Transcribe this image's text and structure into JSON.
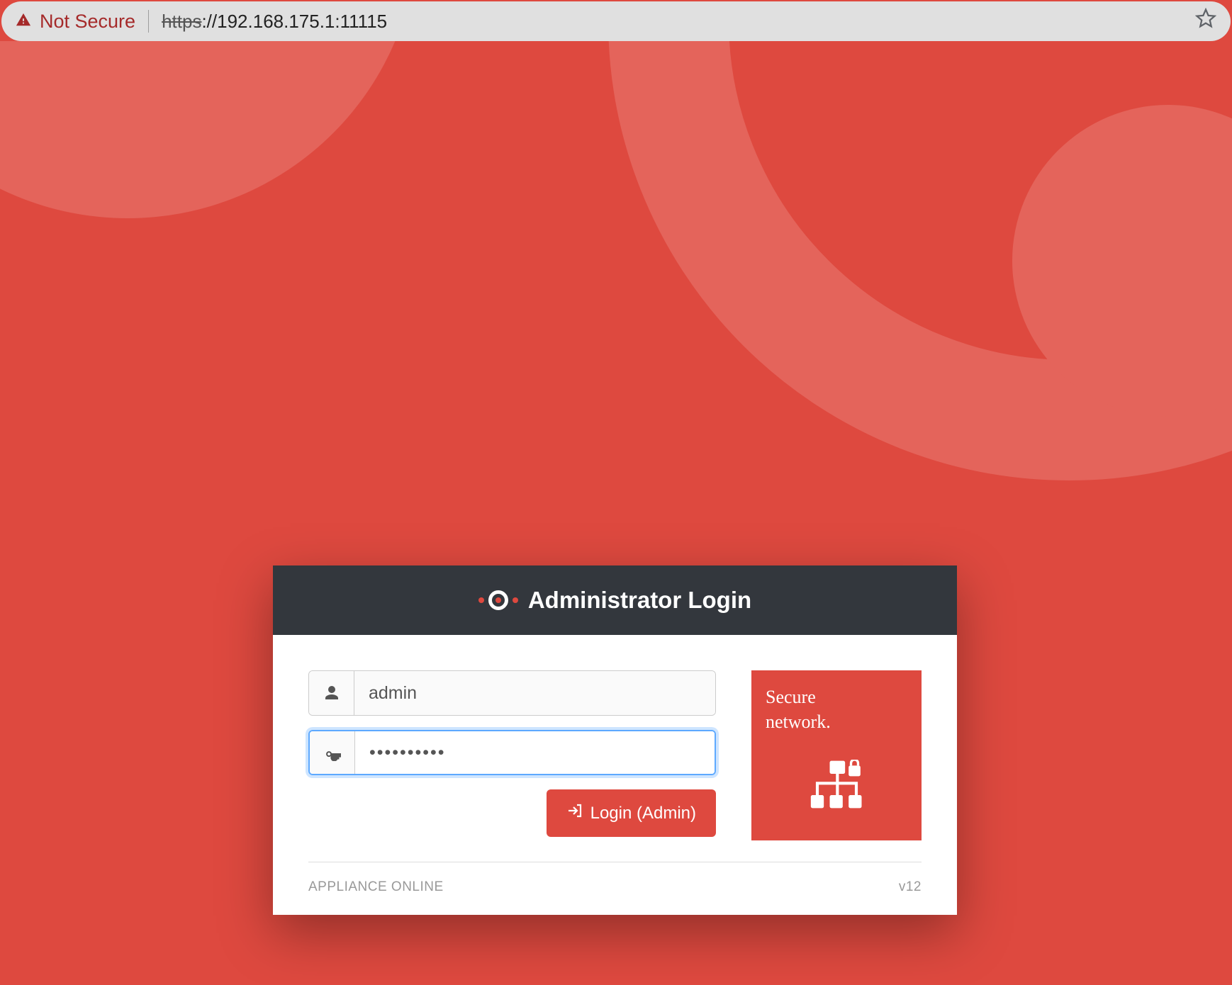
{
  "address_bar": {
    "security_label": "Not Secure",
    "url_scheme": "https",
    "url_remainder": "://192.168.175.1:11115"
  },
  "login": {
    "header_title": "Administrator Login",
    "username_value": "admin",
    "password_value": "••••••••••",
    "login_button_label": "Login (Admin)"
  },
  "promo": {
    "line1": "Secure",
    "line2": "network."
  },
  "footer": {
    "status": "APPLIANCE ONLINE",
    "version": "v12"
  },
  "colors": {
    "brand": "#de493f",
    "header_bg": "#33373d"
  }
}
